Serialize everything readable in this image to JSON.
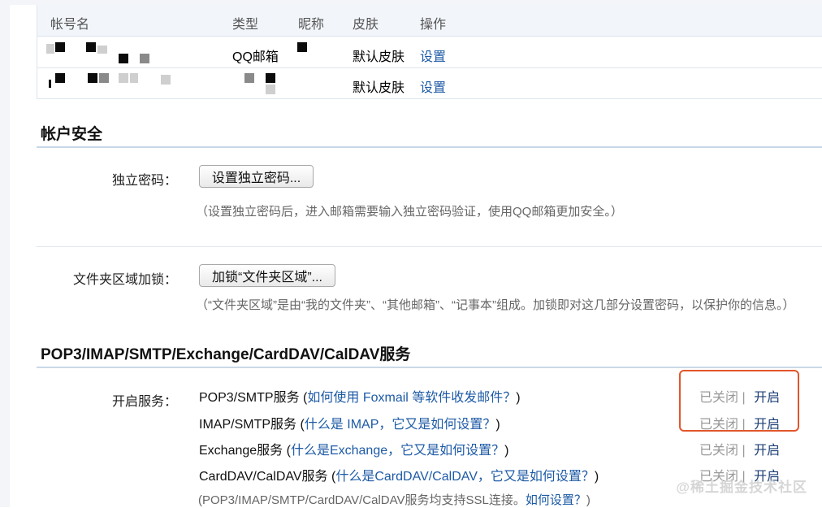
{
  "accounts_table": {
    "headers": [
      "帐号名",
      "类型",
      "昵称",
      "皮肤",
      "操作"
    ],
    "rows": [
      {
        "type": "QQ邮箱",
        "skin": "默认皮肤",
        "action": "设置"
      },
      {
        "type": "",
        "skin": "默认皮肤",
        "action": "设置"
      }
    ]
  },
  "account_security": {
    "title": "帐户安全",
    "password_label": "独立密码：",
    "password_button": "设置独立密码...",
    "password_hint": "（设置独立密码后，进入邮箱需要输入独立密码验证，使用QQ邮箱更加安全。）",
    "folder_lock_label": "文件夹区域加锁：",
    "folder_lock_button": "加锁“文件夹区域”...",
    "folder_lock_hint": "（“文件夹区域”是由“我的文件夹”、“其他邮箱”、“记事本”组成。加锁即对这几部分设置密码，以保护你的信息。）"
  },
  "services": {
    "title": "POP3/IMAP/SMTP/Exchange/CardDAV/CalDAV服务",
    "label": "开启服务：",
    "items": [
      {
        "name": "POP3/SMTP服务",
        "help": "如何使用 Foxmail 等软件收发邮件？",
        "status": "已关闭",
        "sep": "|",
        "action": "开启"
      },
      {
        "name": "IMAP/SMTP服务",
        "help": "什么是 IMAP，它又是如何设置？",
        "status": "已关闭",
        "sep": "|",
        "action": "开启"
      },
      {
        "name": "Exchange服务",
        "help": "什么是Exchange，它又是如何设置？",
        "status": "已关闭",
        "sep": "|",
        "action": "开启"
      },
      {
        "name": "CardDAV/CalDAV服务",
        "help": "什么是CardDAV/CalDAV，它又是如何设置？",
        "status": "已关闭",
        "sep": "|",
        "action": "开启"
      }
    ],
    "ssl_note_prefix": "(POP3/IMAP/SMTP/CardDAV/CalDAV服务均支持SSL连接。",
    "ssl_note_link": "如何设置？",
    "ssl_note_suffix": ")"
  },
  "watermark": "@稀土掘金技术社区",
  "colors": {
    "link": "#1d5aa6",
    "highlight_box": "#e2562b"
  }
}
